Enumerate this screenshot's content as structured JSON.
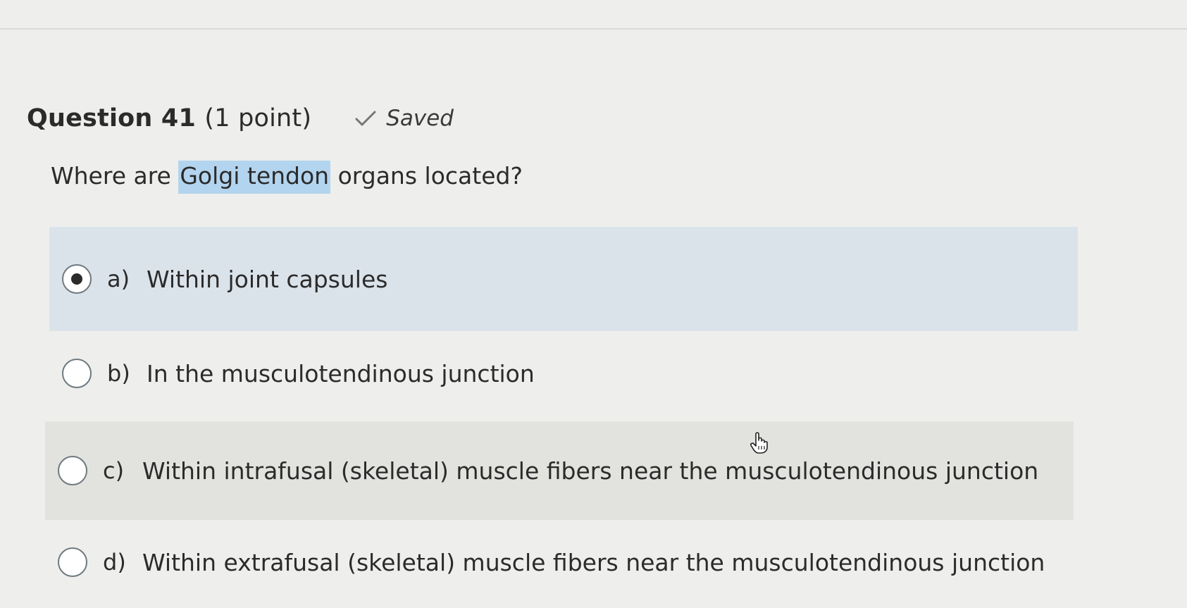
{
  "question": {
    "title": "Question 41",
    "points": "(1 point)",
    "status_icon": "check-icon",
    "status": "Saved",
    "prompt_before": "Where are ",
    "prompt_highlight": "Golgi tendon",
    "prompt_after": " organs located?"
  },
  "answers": [
    {
      "letter": "a)",
      "text": "Within joint capsules",
      "selected": true
    },
    {
      "letter": "b)",
      "text": "In the musculotendinous junction",
      "selected": false
    },
    {
      "letter": "c)",
      "text": "Within intrafusal (skeletal) muscle fibers near the musculotendinous junction",
      "selected": false
    },
    {
      "letter": "d)",
      "text": "Within extrafusal (skeletal) muscle fibers near the musculotendinous junction",
      "selected": false
    }
  ],
  "colors": {
    "selected_answer_bg": "#dbe3ea",
    "hover_answer_bg": "#e2e2df",
    "highlight": "#b3d4ee"
  },
  "cursor": {
    "icon": "hand-cursor-icon"
  }
}
